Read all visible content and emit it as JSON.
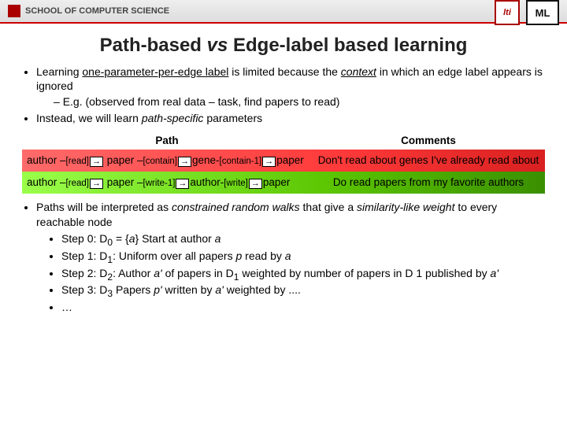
{
  "header": {
    "school": "SCHOOL OF COMPUTER SCIENCE",
    "lti": "lti",
    "ml": "ML"
  },
  "title": {
    "pre": "Path-based ",
    "vs": "vs",
    "post": " Edge-label based learning"
  },
  "bullets": {
    "b1_pre": "Learning ",
    "b1_uline": "one-parameter-per-edge label",
    "b1_mid": " is limited because the ",
    "b1_context": "context",
    "b1_post": " in which an edge label appears is ignored",
    "b1_sub": "E.g. (observed from real data – task, find papers to read)",
    "b2_pre": "Instead, we will learn ",
    "b2_ital": "path-specific",
    "b2_post": " parameters"
  },
  "table": {
    "h_path": "Path",
    "h_comments": "Comments",
    "r1": {
      "t1": "author –",
      "rel1": "[read]",
      "t2": " paper –",
      "rel2": "[contain]",
      "t3": "gene-",
      "rel3": "[contain-1]",
      "t4": "paper",
      "comment": "Don't read about genes I've already read about"
    },
    "r2": {
      "t1": "author –",
      "rel1": "[read]",
      "t2": " paper –",
      "rel2": "[write-1]",
      "t3": "author-",
      "rel3": "[write]",
      "t4": "paper",
      "comment": "Do read papers from my favorite authors"
    }
  },
  "walks": {
    "intro_pre": "Paths will be interpreted as ",
    "intro_i1": "constrained random walks",
    "intro_mid": " that give a ",
    "intro_i2": "similarity-like weight",
    "intro_post": " to every reachable node",
    "s0": "Step 0: D0 = {a} Start at author a",
    "s1": "Step 1: D1: Uniform over all papers p read by a",
    "s2": "Step 2: D2: Author a' of papers in D1 weighted by number of papers in D 1 published by a'",
    "s3": "Step 3: D3 Papers p' written by a' weighted by ....",
    "s4": "…"
  }
}
